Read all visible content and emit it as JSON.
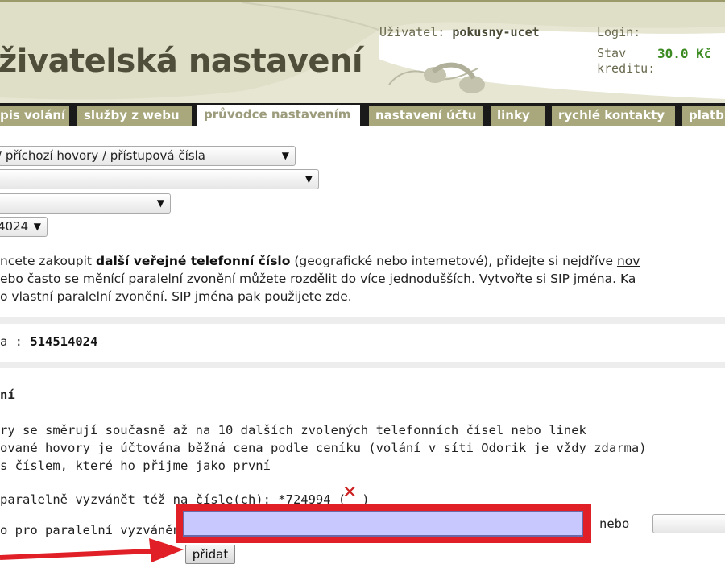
{
  "header": {
    "title": "živatelská nastavení",
    "user_label": "Uživatel:",
    "user_name": "pokusny-ucet",
    "login_label": "Login:",
    "credit_label": "Stav kreditu:",
    "credit_value": "30.0 Kč"
  },
  "tabs": [
    {
      "label": "pis volání",
      "active": false
    },
    {
      "label": "služby z webu",
      "active": false
    },
    {
      "label": "průvodce nastavením",
      "active": true
    },
    {
      "label": "nastavení účtu",
      "active": false
    },
    {
      "label": "linky",
      "active": false
    },
    {
      "label": "rychlé kontakty",
      "active": false
    },
    {
      "label": "platb",
      "active": false
    }
  ],
  "selects": {
    "s1": "/ příchozí hovory / přístupová čísla",
    "s2": "",
    "s3": "",
    "s4": "4024"
  },
  "intro": {
    "l1_a": "ncete zakoupit ",
    "l1_b": "další veřejné telefonní číslo",
    "l1_c": " (geografické nebo internetové), přidejte si nejdříve ",
    "l1_link": "nov",
    "l2_a": "ebo často se měnící paralelní zvonění můžete rozdělit do více jednodušších. Vytvořte si ",
    "l2_link": "SIP jména",
    "l2_b": ". Ka",
    "l3": "o vlastní paralelní zvonění. SIP jména pak použijete zde."
  },
  "number_panel": {
    "label": "a : ",
    "number": "514514024"
  },
  "section": {
    "heading": "ní",
    "line1": "ry se směrují současně až na 10 dalších zvolených telefonních čísel nebo linek",
    "line2": "ované hovory je účtována běžná cena podle ceníku (volání v síti Odorik je vždy zdarma)",
    "line3": " s číslem, které ho přijme jako první",
    "ring_also": " paralelně vyzvánět též na čísle(ch): *724994 (",
    "ring_close": ")",
    "input_label": "o pro paralelní vyzvánění",
    "input_value": "",
    "or_label": "nebo",
    "add_button": "přidat"
  },
  "colors": {
    "tab_bg": "#a8a87c",
    "credit": "#3c8a22",
    "highlight": "#e11f27",
    "input_bg": "#c8c8ff"
  }
}
